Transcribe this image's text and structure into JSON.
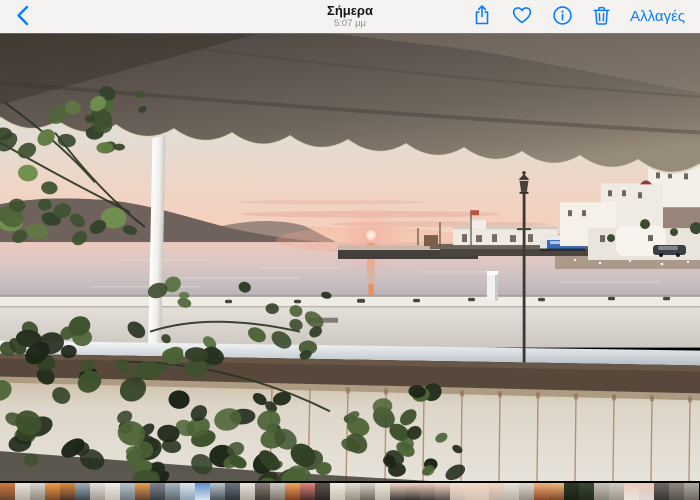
{
  "toolbar": {
    "title": "Σήμερα",
    "time": "5:07 μμ",
    "edit_label": "Αλλαγές",
    "accent_color": "#0a7cff",
    "icons": [
      "chevron-left-icon",
      "share-icon",
      "heart-icon",
      "info-icon",
      "trash-icon"
    ]
  },
  "photo": {
    "description": "Sunset over a Greek island harbor seen from a terrace: scalloped awning on top, green plant at left, pale sea with setting sun, breakwater pier with a blue truck, white village houses under a hill at right, street lamp, white quay and a canvas-covered railing in the foreground."
  },
  "scrubber": {
    "thumbnails": [
      {
        "w": 15,
        "top": "#cf7a3e",
        "bottom": "#6a4630"
      },
      {
        "w": 15,
        "top": "#e9e5df",
        "bottom": "#b5aea4"
      },
      {
        "w": 15,
        "top": "#d9d5cd",
        "bottom": "#8f897f"
      },
      {
        "w": 15,
        "top": "#ef9d4c",
        "bottom": "#7c4a28"
      },
      {
        "w": 15,
        "top": "#d98a43",
        "bottom": "#4e342a"
      },
      {
        "w": 15,
        "top": "#9fb0bd",
        "bottom": "#3d4a52"
      },
      {
        "w": 15,
        "top": "#e3e0da",
        "bottom": "#a09a90"
      },
      {
        "w": 15,
        "top": "#edebe7",
        "bottom": "#c4beb4"
      },
      {
        "w": 15,
        "top": "#b8c3c9",
        "bottom": "#6e7a80"
      },
      {
        "w": 15,
        "top": "#e9a050",
        "bottom": "#64422c"
      },
      {
        "w": 15,
        "top": "#7e848a",
        "bottom": "#3a3f44"
      },
      {
        "w": 15,
        "top": "#a9b6c0",
        "bottom": "#5d6871"
      },
      {
        "w": 15,
        "top": "#dce4ea",
        "bottom": "#8fa3b5"
      },
      {
        "w": 15,
        "top": "#5e8fd0",
        "bottom": "#d8e2ec"
      },
      {
        "w": 15,
        "top": "#b9c4cc",
        "bottom": "#4a545c"
      },
      {
        "w": 15,
        "top": "#6b7480",
        "bottom": "#2e343c"
      },
      {
        "w": 15,
        "top": "#e6e3dd",
        "bottom": "#b0a89c"
      },
      {
        "w": 15,
        "top": "#8a8278",
        "bottom": "#403a32"
      },
      {
        "w": 15,
        "top": "#cfc9c0",
        "bottom": "#7e766a"
      },
      {
        "w": 15,
        "top": "#f0a85c",
        "bottom": "#803f20"
      },
      {
        "w": 15,
        "top": "#e2857a",
        "bottom": "#4a2e28"
      },
      {
        "w": 15,
        "top": "#5a5550",
        "bottom": "#2a2622"
      },
      {
        "w": 15,
        "top": "#efe9e0",
        "bottom": "#c8c0b2"
      },
      {
        "w": 15,
        "top": "#e2dcd2",
        "bottom": "#988e80"
      },
      {
        "w": 15,
        "top": "#d8d2c8",
        "bottom": "#6e665c"
      },
      {
        "w": 15,
        "top": "#ece6dc",
        "bottom": "#beb6a8"
      },
      {
        "w": 15,
        "top": "#f2d8c8",
        "bottom": "#3f3a36"
      },
      {
        "w": 15,
        "top": "#f4d4c4",
        "bottom": "#35322e"
      },
      {
        "w": 15,
        "top": "#f2cfc2",
        "bottom": "#45403a"
      },
      {
        "w": 15,
        "top": "#f5d8c9",
        "bottom": "#57504a"
      },
      {
        "w": 15,
        "top": "#f6dccd",
        "bottom": "#c9b8ac"
      },
      {
        "w": 24,
        "top": "#f4d9c8",
        "bottom": "#d3c2b4"
      },
      {
        "w": 15,
        "top": "#f2d5c6",
        "bottom": "#beaea2"
      },
      {
        "w": 15,
        "top": "#e8e2da",
        "bottom": "#b8b0a4"
      },
      {
        "w": 15,
        "top": "#dfd9d0",
        "bottom": "#948c80"
      },
      {
        "w": 15,
        "top": "#f0b27a",
        "bottom": "#8a4a2a"
      },
      {
        "w": 15,
        "top": "#f2b880",
        "bottom": "#7e452a"
      },
      {
        "w": 15,
        "top": "#2f3a2a",
        "bottom": "#182014"
      },
      {
        "w": 15,
        "top": "#3a4a34",
        "bottom": "#202a1c"
      },
      {
        "w": 15,
        "top": "#c8c2ba",
        "bottom": "#888278"
      },
      {
        "w": 15,
        "top": "#d2ccc2",
        "bottom": "#9a948a"
      },
      {
        "w": 15,
        "top": "#f0cabc",
        "bottom": "#e8e4de"
      },
      {
        "w": 15,
        "top": "#eec6b8",
        "bottom": "#dcd8d2"
      },
      {
        "w": 15,
        "top": "#6e6862",
        "bottom": "#3a3632"
      },
      {
        "w": 15,
        "top": "#8e8880",
        "bottom": "#55504a"
      },
      {
        "w": 15,
        "top": "#b0aaa2",
        "bottom": "#6e6862"
      }
    ]
  }
}
